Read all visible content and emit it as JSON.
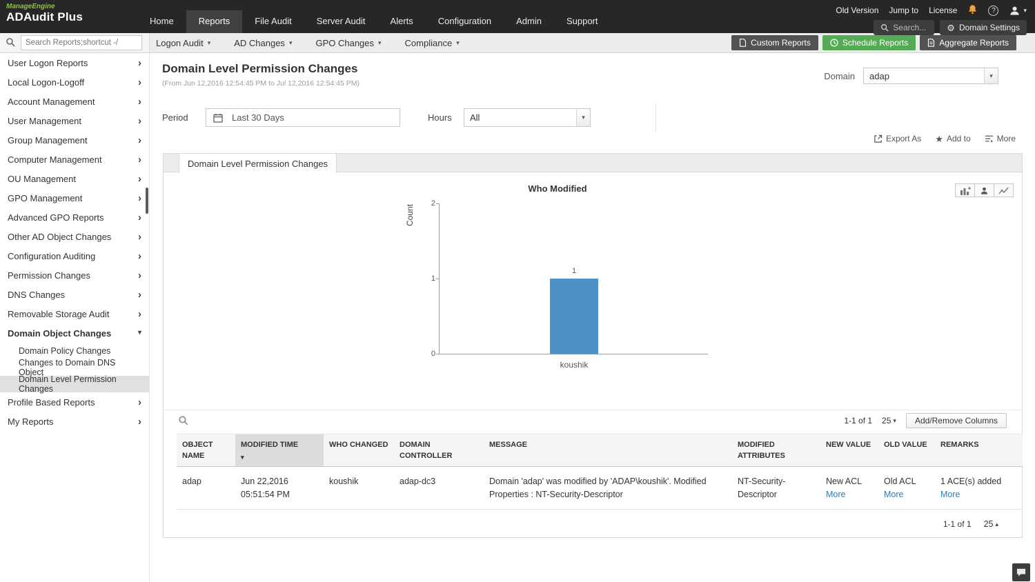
{
  "topbar": {
    "brand_line1": "ManageEngine",
    "brand_line2": "ADAudit Plus",
    "nav": [
      {
        "label": "Home",
        "active": false
      },
      {
        "label": "Reports",
        "active": true
      },
      {
        "label": "File Audit",
        "active": false
      },
      {
        "label": "Server Audit",
        "active": false
      },
      {
        "label": "Alerts",
        "active": false
      },
      {
        "label": "Configuration",
        "active": false
      },
      {
        "label": "Admin",
        "active": false
      },
      {
        "label": "Support",
        "active": false
      }
    ],
    "utility_links": [
      "Old Version",
      "Jump to",
      "License"
    ],
    "help_label": "?",
    "search_label": "Search...",
    "domain_settings_label": "Domain Settings"
  },
  "toolbar": {
    "search_placeholder": "Search Reports;shortcut -/",
    "menus": [
      {
        "label": "Logon Audit"
      },
      {
        "label": "AD Changes"
      },
      {
        "label": "GPO Changes"
      },
      {
        "label": "Compliance"
      }
    ],
    "buttons": {
      "custom": "Custom Reports",
      "schedule": "Schedule Reports",
      "aggregate": "Aggregate Reports"
    }
  },
  "sidebar": {
    "items": [
      {
        "label": "User Logon Reports"
      },
      {
        "label": "Local Logon-Logoff"
      },
      {
        "label": "Account Management"
      },
      {
        "label": "User Management"
      },
      {
        "label": "Group Management"
      },
      {
        "label": "Computer Management"
      },
      {
        "label": "OU Management"
      },
      {
        "label": "GPO Management"
      },
      {
        "label": "Advanced GPO Reports"
      },
      {
        "label": "Other AD Object Changes"
      },
      {
        "label": "Configuration Auditing"
      },
      {
        "label": "Permission Changes"
      },
      {
        "label": "DNS Changes"
      },
      {
        "label": "Removable Storage Audit"
      },
      {
        "label": "Domain Object Changes",
        "expanded": true,
        "children": [
          {
            "label": "Domain Policy Changes",
            "selected": false
          },
          {
            "label": "Changes to Domain DNS Object",
            "selected": false
          },
          {
            "label": "Domain Level Permission Changes",
            "selected": true
          }
        ]
      },
      {
        "label": "Profile Based Reports"
      },
      {
        "label": "My Reports"
      }
    ]
  },
  "report": {
    "title": "Domain Level Permission Changes",
    "subtitle": "(From Jun 12,2016 12:54:45 PM to Jul 12,2016 12:54:45 PM)",
    "domain_label": "Domain",
    "domain_value": "adap",
    "period_label": "Period",
    "period_value": "Last 30 Days",
    "hours_label": "Hours",
    "hours_value": "All",
    "actions": {
      "export": "Export As",
      "add": "Add to",
      "more": "More"
    },
    "tab_label": "Domain Level Permission Changes"
  },
  "chart_data": {
    "type": "bar",
    "title": "Who Modified",
    "xlabel": "",
    "ylabel": "Count",
    "categories": [
      "koushik"
    ],
    "values": [
      1
    ],
    "ylim": [
      0,
      2
    ],
    "yticks": [
      0,
      1,
      2
    ],
    "grid": false,
    "bar_color": "#4d92c6"
  },
  "table": {
    "count_text": "1-1 of 1",
    "page_size": "25",
    "add_remove_label": "Add/Remove Columns",
    "columns": [
      "OBJECT NAME",
      "MODIFIED TIME",
      "WHO CHANGED",
      "DOMAIN CONTROLLER",
      "MESSAGE",
      "MODIFIED ATTRIBUTES",
      "NEW VALUE",
      "OLD VALUE",
      "REMARKS"
    ],
    "rows": [
      {
        "object_name": "adap",
        "modified_time": "Jun 22,2016 05:51:54 PM",
        "who_changed": "koushik",
        "domain_controller": "adap-dc3",
        "message": "Domain 'adap' was modified by 'ADAP\\koushik'. Modified Properties : NT-Security-Descriptor",
        "modified_attributes": "NT-Security-Descriptor",
        "new_value": "New ACL",
        "new_value_link": "More",
        "old_value": "Old ACL",
        "old_value_link": "More",
        "remarks": "1 ACE(s) added",
        "remarks_link": "More"
      }
    ],
    "footer_count_text": "1-1 of 1",
    "footer_page_size": "25"
  }
}
